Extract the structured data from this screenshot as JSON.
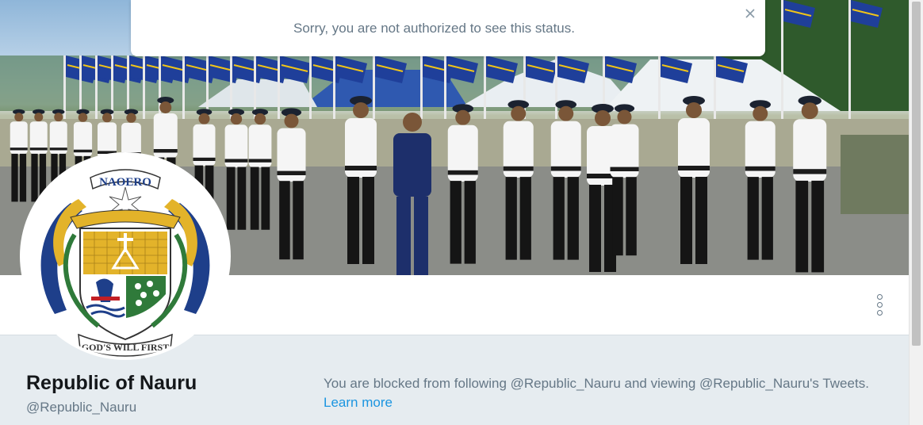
{
  "toast": {
    "message": "Sorry, you are not authorized to see this status.",
    "close_icon": "close-icon"
  },
  "profile": {
    "display_name": "Republic of Nauru",
    "handle": "@Republic_Nauru",
    "blocked_message": "You are blocked from following @Republic_Nauru and viewing @Republic_Nauru's Tweets.",
    "learn_more_label": "Learn more",
    "more_icon": "more-vertical-icon"
  },
  "avatar": {
    "seal_top_text": "NAOERO",
    "seal_bottom_text": "GOD'S WILL FIRST"
  },
  "colors": {
    "link": "#1b95e0",
    "secondary_text": "#657786",
    "primary_text": "#14171a",
    "page_background": "#e6ecf0"
  }
}
